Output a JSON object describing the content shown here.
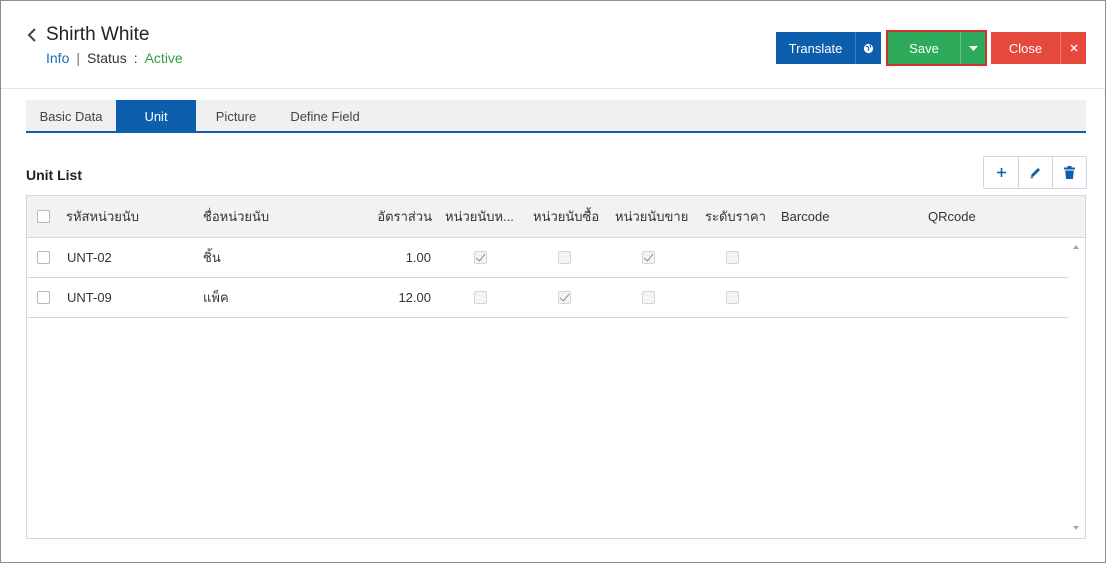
{
  "header": {
    "title": "Shirth White",
    "info_link": "Info",
    "separator": "|",
    "status_label": "Status",
    "status_colon": ":",
    "status_value": "Active"
  },
  "actions": {
    "translate_label": "Translate",
    "save_label": "Save",
    "close_label": "Close"
  },
  "tabs": [
    {
      "label": "Basic Data",
      "active": false
    },
    {
      "label": "Unit",
      "active": true
    },
    {
      "label": "Picture",
      "active": false
    },
    {
      "label": "Define Field",
      "active": false
    }
  ],
  "unit_list": {
    "title": "Unit List",
    "columns": [
      "รหัสหน่วยนับ",
      "ชื่อหน่วยนับ",
      "อัตราส่วน",
      "หน่วยนับห...",
      "หน่วยนับซื้อ",
      "หน่วยนับขาย",
      "ระดับราคา",
      "Barcode",
      "QRcode"
    ],
    "rows": [
      {
        "code": "UNT-02",
        "name": "ชิ้น",
        "ratio": "1.00",
        "default_unit": true,
        "purchase_unit": false,
        "sales_unit": true,
        "price_level": false,
        "barcode": "",
        "qrcode": ""
      },
      {
        "code": "UNT-09",
        "name": "แพ็ค",
        "ratio": "12.00",
        "default_unit": false,
        "purchase_unit": true,
        "sales_unit": false,
        "price_level": false,
        "barcode": "",
        "qrcode": ""
      }
    ]
  },
  "colors": {
    "primary": "#0d5eac",
    "save": "#2daa5a",
    "close": "#e5483d",
    "status": "#2e9e45",
    "link": "#1a6fb8"
  }
}
